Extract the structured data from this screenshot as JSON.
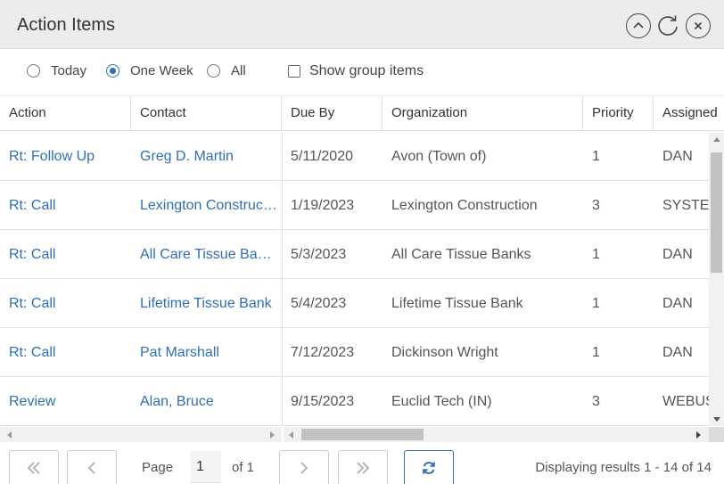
{
  "header": {
    "title": "Action Items",
    "icons": [
      "chevron-up-icon",
      "refresh-icon",
      "close-icon"
    ]
  },
  "filters": {
    "options": [
      {
        "label": "Today",
        "checked": false
      },
      {
        "label": "One Week",
        "checked": true
      },
      {
        "label": "All",
        "checked": false
      }
    ],
    "show_group_items": {
      "label": "Show group items",
      "checked": false
    }
  },
  "table": {
    "columns": [
      "Action",
      "Contact",
      "Due By",
      "Organization",
      "Priority",
      "Assigned"
    ],
    "rows": [
      {
        "action": "Rt: Follow Up",
        "contact": "Greg D. Martin",
        "due": "5/11/2020",
        "org": "Avon (Town of)",
        "priority": "1",
        "assigned": "DAN"
      },
      {
        "action": "Rt: Call",
        "contact": "Lexington Construction",
        "due": "1/19/2023",
        "org": "Lexington Construction",
        "priority": "3",
        "assigned": "SYSTEM"
      },
      {
        "action": "Rt: Call",
        "contact": "All Care Tissue Banks",
        "due": "5/3/2023",
        "org": "All Care Tissue Banks",
        "priority": "1",
        "assigned": "DAN"
      },
      {
        "action": "Rt: Call",
        "contact": "Lifetime Tissue Bank",
        "due": "5/4/2023",
        "org": "Lifetime Tissue Bank",
        "priority": "1",
        "assigned": "DAN"
      },
      {
        "action": "Rt: Call",
        "contact": "Pat Marshall",
        "due": "7/12/2023",
        "org": "Dickinson Wright",
        "priority": "1",
        "assigned": "DAN"
      },
      {
        "action": "Review",
        "contact": "Alan, Bruce",
        "due": "9/15/2023",
        "org": "Euclid Tech (IN)",
        "priority": "3",
        "assigned": "WEBUSER"
      }
    ]
  },
  "pager": {
    "page_label": "Page",
    "page_value": "1",
    "of_label": "of 1",
    "display_info": "Displaying results 1 - 14 of 14"
  },
  "colors": {
    "link": "#2f6fb7",
    "header_bg": "#ececec"
  }
}
